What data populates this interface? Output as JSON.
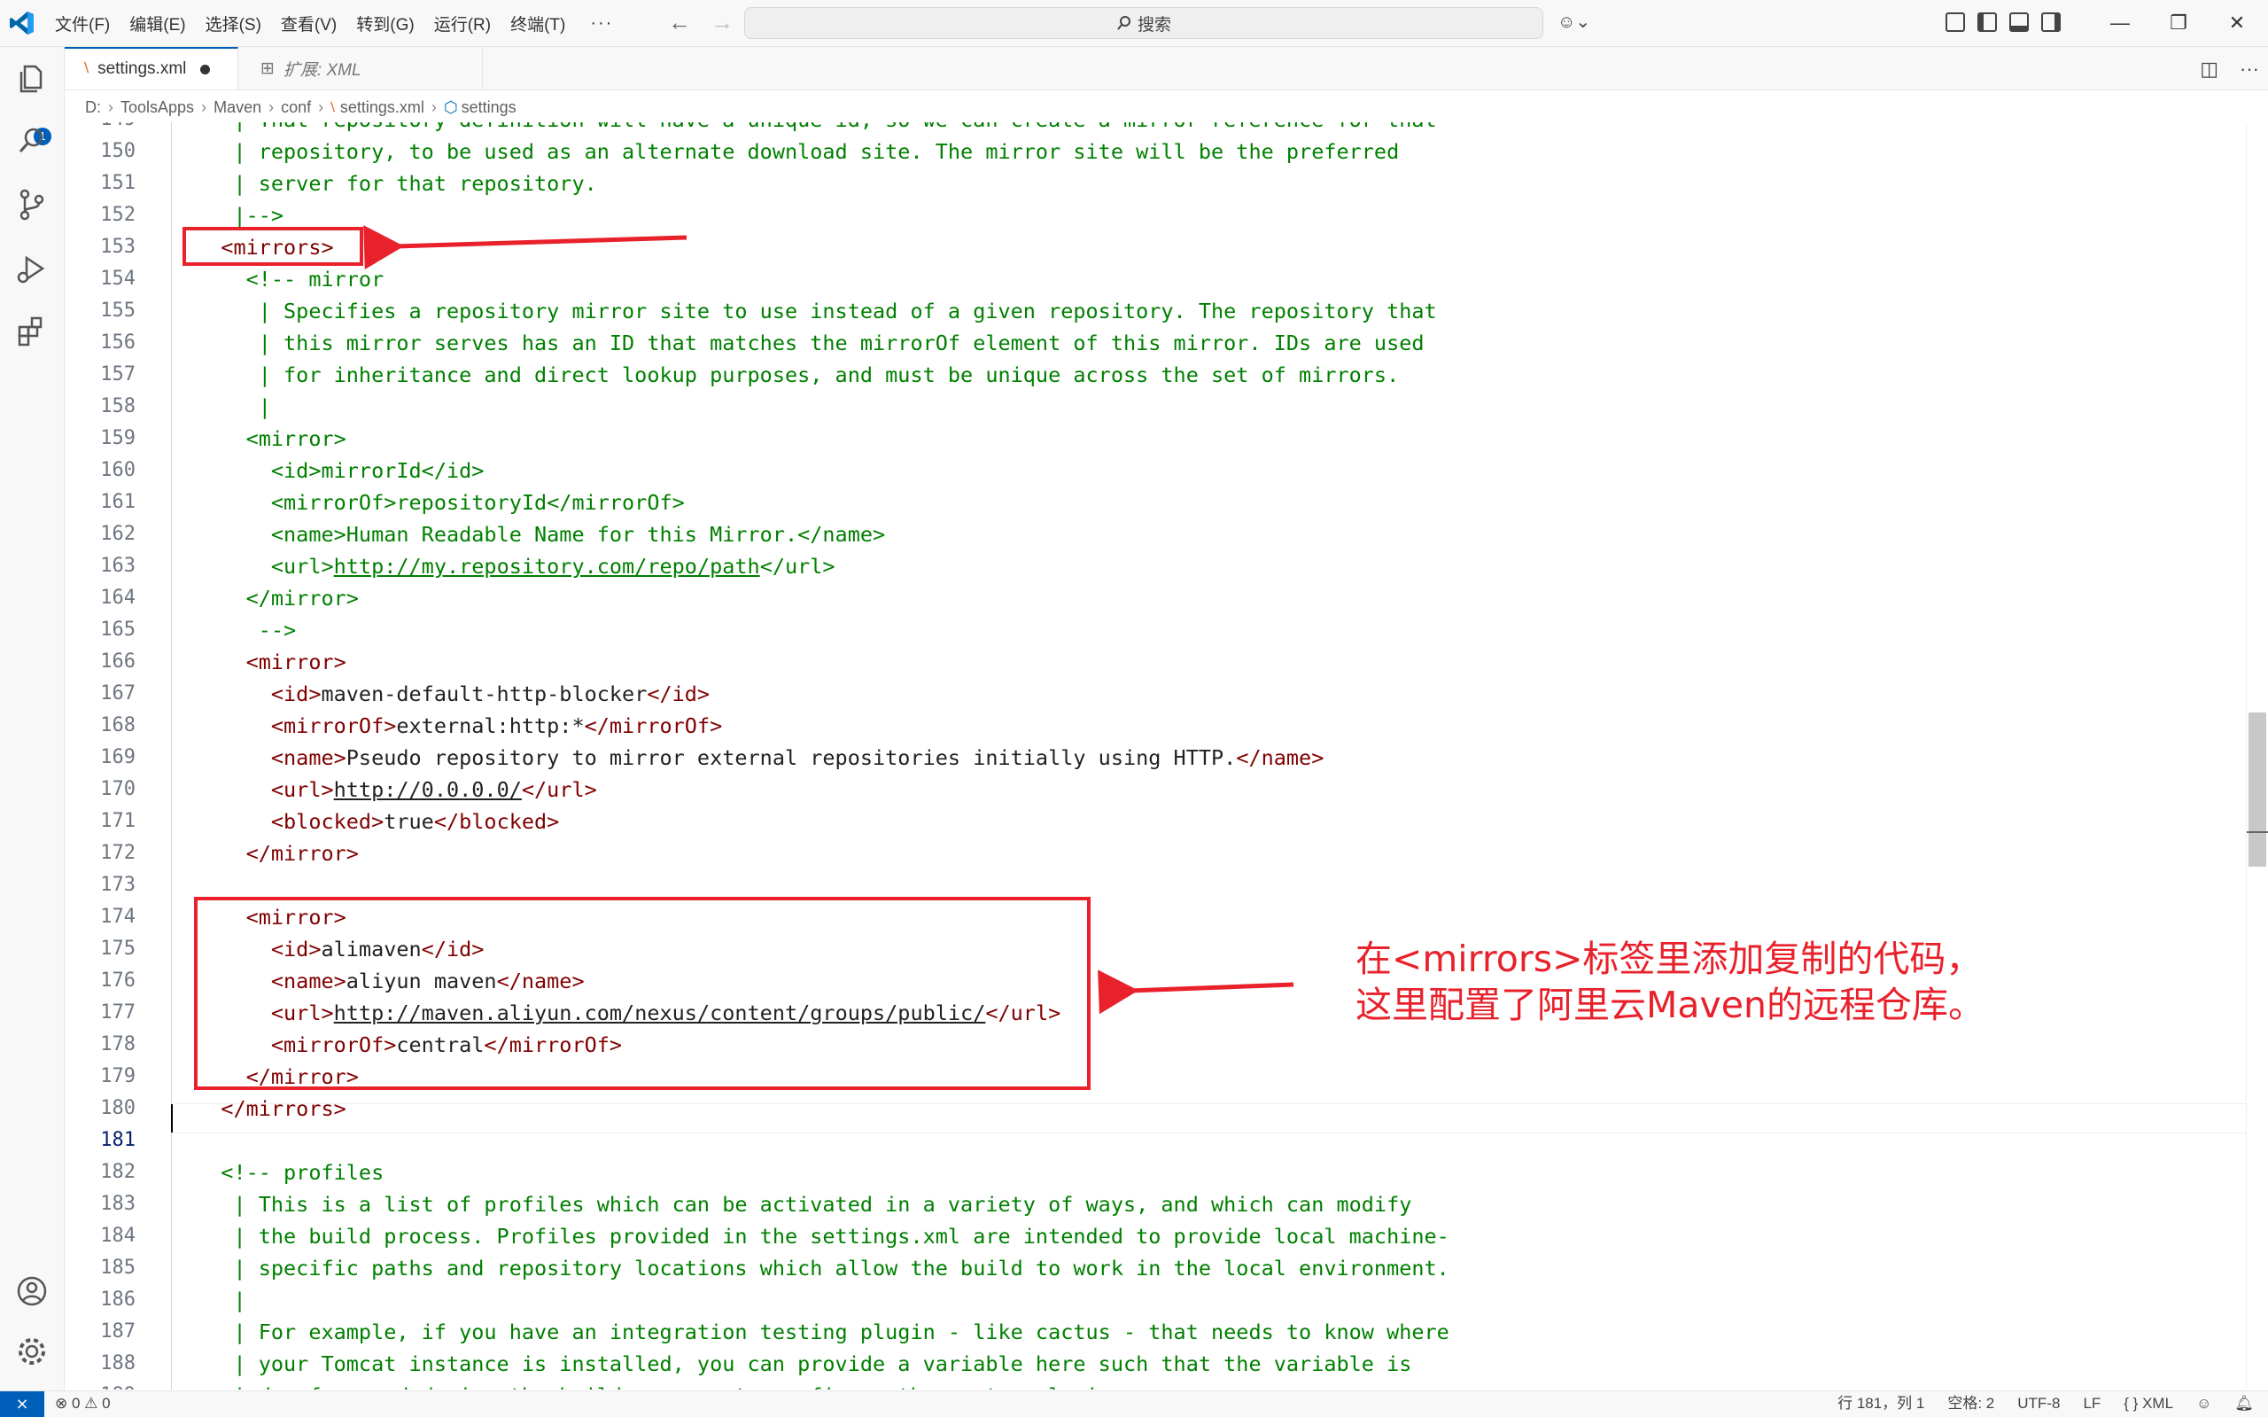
{
  "menu": [
    "文件(F)",
    "编辑(E)",
    "选择(S)",
    "查看(V)",
    "转到(G)",
    "运行(R)",
    "终端(T)"
  ],
  "menu_more": "···",
  "search_placeholder": "搜索",
  "tabs": [
    {
      "label": "settings.xml",
      "dirty": true
    },
    {
      "label": "扩展: XML"
    }
  ],
  "breadcrumb": [
    "D:",
    "ToolsApps",
    "Maven",
    "conf",
    "settings.xml",
    "settings"
  ],
  "explorer_badge": "1",
  "lines": [
    {
      "n": 149,
      "parts": [
        [
          "c",
          "   | That repository definition will have a unique id, so we can create a mirror reference for that"
        ]
      ]
    },
    {
      "n": 150,
      "parts": [
        [
          "c",
          "   | repository, to be used as an alternate download site. The mirror site will be the preferred"
        ]
      ]
    },
    {
      "n": 151,
      "parts": [
        [
          "c",
          "   | server for that repository."
        ]
      ]
    },
    {
      "n": 152,
      "parts": [
        [
          "c",
          "   |-->"
        ]
      ]
    },
    {
      "n": 153,
      "parts": [
        [
          "p",
          "  "
        ],
        [
          "t",
          "<mirrors>"
        ]
      ]
    },
    {
      "n": 154,
      "parts": [
        [
          "p",
          "    "
        ],
        [
          "c",
          "<!-- mirror"
        ]
      ]
    },
    {
      "n": 155,
      "parts": [
        [
          "c",
          "     | Specifies a repository mirror site to use instead of a given repository. The repository that"
        ]
      ]
    },
    {
      "n": 156,
      "parts": [
        [
          "c",
          "     | this mirror serves has an ID that matches the mirrorOf element of this mirror. IDs are used"
        ]
      ]
    },
    {
      "n": 157,
      "parts": [
        [
          "c",
          "     | for inheritance and direct lookup purposes, and must be unique across the set of mirrors."
        ]
      ]
    },
    {
      "n": 158,
      "parts": [
        [
          "c",
          "     |"
        ]
      ]
    },
    {
      "n": 159,
      "parts": [
        [
          "c",
          "    <mirror>"
        ]
      ]
    },
    {
      "n": 160,
      "parts": [
        [
          "c",
          "      <id>mirrorId</id>"
        ]
      ]
    },
    {
      "n": 161,
      "parts": [
        [
          "c",
          "      <mirrorOf>repositoryId</mirrorOf>"
        ]
      ]
    },
    {
      "n": 162,
      "parts": [
        [
          "c",
          "      <name>Human Readable Name for this Mirror.</name>"
        ]
      ]
    },
    {
      "n": 163,
      "parts": [
        [
          "c",
          "      <url>"
        ],
        [
          "cu",
          "http://my.repository.com/repo/path"
        ],
        [
          "c",
          "</url>"
        ]
      ]
    },
    {
      "n": 164,
      "parts": [
        [
          "c",
          "    </mirror>"
        ]
      ]
    },
    {
      "n": 165,
      "parts": [
        [
          "c",
          "     -->"
        ]
      ]
    },
    {
      "n": 166,
      "parts": [
        [
          "p",
          "    "
        ],
        [
          "t",
          "<mirror>"
        ]
      ]
    },
    {
      "n": 167,
      "parts": [
        [
          "p",
          "      "
        ],
        [
          "t",
          "<id>"
        ],
        [
          "x",
          "maven-default-http-blocker"
        ],
        [
          "t",
          "</id>"
        ]
      ]
    },
    {
      "n": 168,
      "parts": [
        [
          "p",
          "      "
        ],
        [
          "t",
          "<mirrorOf>"
        ],
        [
          "x",
          "external:http:*"
        ],
        [
          "t",
          "</mirrorOf>"
        ]
      ]
    },
    {
      "n": 169,
      "parts": [
        [
          "p",
          "      "
        ],
        [
          "t",
          "<name>"
        ],
        [
          "x",
          "Pseudo repository to mirror external repositories initially using HTTP."
        ],
        [
          "t",
          "</name>"
        ]
      ]
    },
    {
      "n": 170,
      "parts": [
        [
          "p",
          "      "
        ],
        [
          "t",
          "<url>"
        ],
        [
          "xu",
          "http://0.0.0.0/"
        ],
        [
          "t",
          "</url>"
        ]
      ]
    },
    {
      "n": 171,
      "parts": [
        [
          "p",
          "      "
        ],
        [
          "t",
          "<blocked>"
        ],
        [
          "x",
          "true"
        ],
        [
          "t",
          "</blocked>"
        ]
      ]
    },
    {
      "n": 172,
      "parts": [
        [
          "p",
          "    "
        ],
        [
          "t",
          "</mirror>"
        ]
      ]
    },
    {
      "n": 173,
      "parts": []
    },
    {
      "n": 174,
      "parts": [
        [
          "p",
          "    "
        ],
        [
          "t",
          "<mirror>"
        ]
      ]
    },
    {
      "n": 175,
      "parts": [
        [
          "p",
          "      "
        ],
        [
          "t",
          "<id>"
        ],
        [
          "x",
          "alimaven"
        ],
        [
          "t",
          "</id>"
        ]
      ]
    },
    {
      "n": 176,
      "parts": [
        [
          "p",
          "      "
        ],
        [
          "t",
          "<name>"
        ],
        [
          "x",
          "aliyun maven"
        ],
        [
          "t",
          "</name>"
        ]
      ]
    },
    {
      "n": 177,
      "parts": [
        [
          "p",
          "      "
        ],
        [
          "t",
          "<url>"
        ],
        [
          "xu",
          "http://maven.aliyun.com/nexus/content/groups/public/"
        ],
        [
          "t",
          "</url>"
        ]
      ]
    },
    {
      "n": 178,
      "parts": [
        [
          "p",
          "      "
        ],
        [
          "t",
          "<mirrorOf>"
        ],
        [
          "x",
          "central"
        ],
        [
          "t",
          "</mirrorOf>"
        ]
      ]
    },
    {
      "n": 179,
      "parts": [
        [
          "p",
          "    "
        ],
        [
          "t",
          "</mirror>"
        ]
      ]
    },
    {
      "n": 180,
      "parts": [
        [
          "p",
          "  "
        ],
        [
          "t",
          "</mirrors>"
        ]
      ]
    },
    {
      "n": 181,
      "parts": [],
      "current": true
    },
    {
      "n": 182,
      "parts": [
        [
          "p",
          "  "
        ],
        [
          "c",
          "<!-- profiles"
        ]
      ]
    },
    {
      "n": 183,
      "parts": [
        [
          "c",
          "   | This is a list of profiles which can be activated in a variety of ways, and which can modify"
        ]
      ]
    },
    {
      "n": 184,
      "parts": [
        [
          "c",
          "   | the build process. Profiles provided in the settings.xml are intended to provide local machine-"
        ]
      ]
    },
    {
      "n": 185,
      "parts": [
        [
          "c",
          "   | specific paths and repository locations which allow the build to work in the local environment."
        ]
      ]
    },
    {
      "n": 186,
      "parts": [
        [
          "c",
          "   |"
        ]
      ]
    },
    {
      "n": 187,
      "parts": [
        [
          "c",
          "   | For example, if you have an integration testing plugin - like cactus - that needs to know where"
        ]
      ]
    },
    {
      "n": 188,
      "parts": [
        [
          "c",
          "   | your Tomcat instance is installed, you can provide a variable here such that the variable is"
        ]
      ]
    },
    {
      "n": 189,
      "parts": [
        [
          "c",
          "   | dereferenced during the build process to configure the cactus plugin."
        ]
      ]
    }
  ],
  "annotation": {
    "line1": "在<mirrors>标签里添加复制的代码，",
    "line2": "这里配置了阿里云Maven的远程仓库。",
    "color": "#e8212b"
  },
  "status": {
    "problems": "⊗ 0 ⚠ 0",
    "position": "行 181，列 1",
    "spaces": "空格: 2",
    "encoding": "UTF-8",
    "eol": "LF",
    "language": "{ } XML"
  },
  "colors": {
    "accent": "#005fb8",
    "tag": "#800000",
    "comment": "#008000"
  }
}
